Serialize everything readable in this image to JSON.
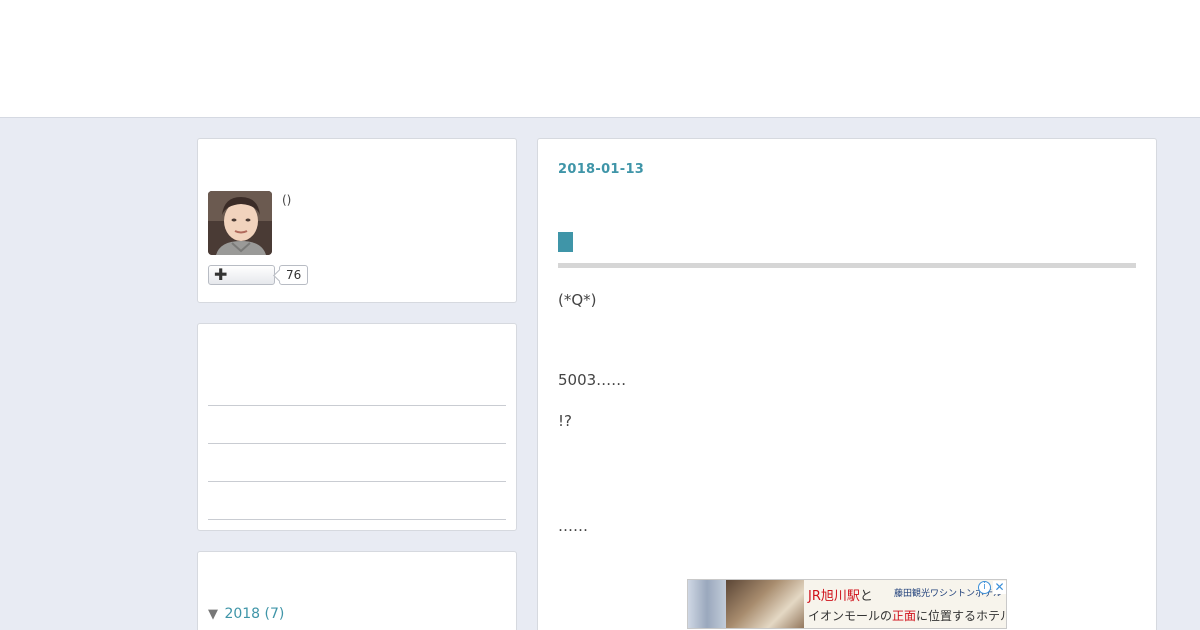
{
  "profile": {
    "name": "()",
    "follow_count": "76"
  },
  "sidebar_archive": {
    "year_label": "2018 (7)"
  },
  "article": {
    "date": "2018-01-13",
    "paragraphs": [
      "(*Q*)",
      "5003……",
      "!?",
      "……"
    ]
  },
  "ad": {
    "line1_prefix": "JR旭川駅",
    "line1_suffix": "と",
    "line2_prefix": "イオンモールの",
    "line2_highlight": "正面",
    "line2_suffix": "に位置するホテルです。",
    "hotel_name": "藤田観光ワシントンホテル",
    "info_glyph": "i",
    "close_glyph": "✕"
  },
  "colors": {
    "accent": "#3f95a8",
    "background": "#e8ebf3",
    "ad_red": "#d0121b"
  }
}
